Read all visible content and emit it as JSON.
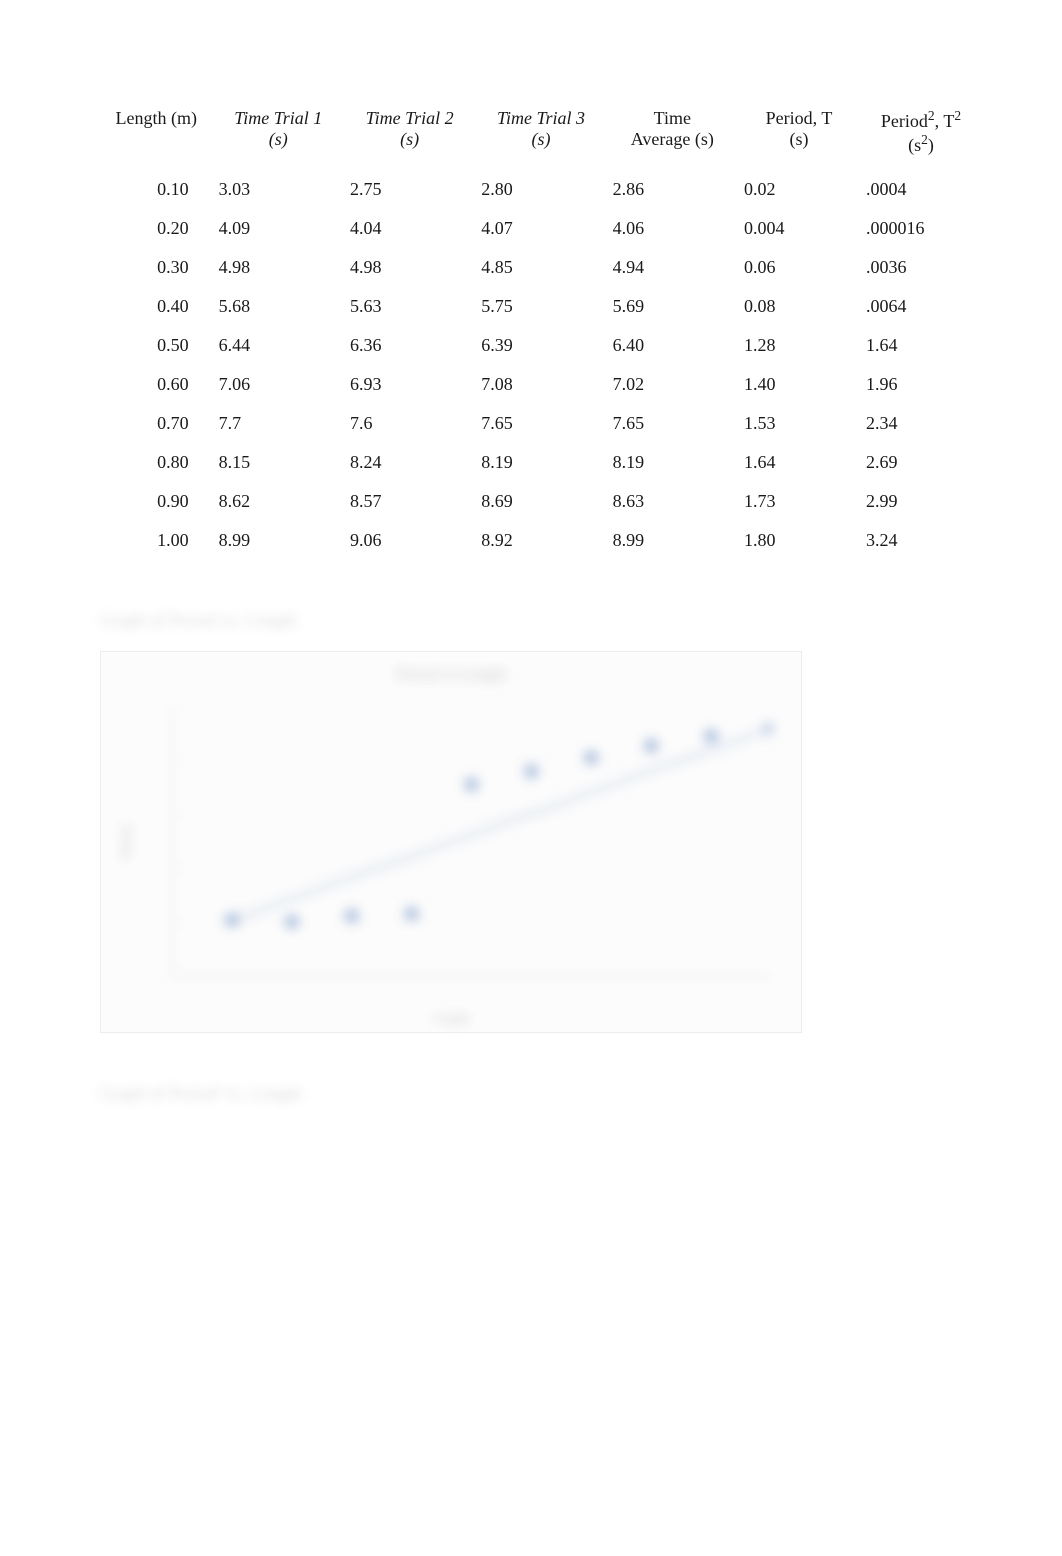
{
  "table": {
    "headers": [
      {
        "l1": "Length (m)",
        "l2": ""
      },
      {
        "l1": "Time Trial 1",
        "l2": "(s)"
      },
      {
        "l1": "Time Trial 2",
        "l2": "(s)"
      },
      {
        "l1": "Time Trial 3",
        "l2": "(s)"
      },
      {
        "l1": "Time",
        "l2": "Average (s)"
      },
      {
        "l1": "Period, T",
        "l2": "(s)"
      },
      {
        "l1": "Period², T²",
        "l2": "(s²)"
      }
    ],
    "rows": [
      [
        "0.10",
        "3.03",
        "2.75",
        "2.80",
        "2.86",
        "0.02",
        ".0004"
      ],
      [
        "0.20",
        "4.09",
        "4.04",
        "4.07",
        "4.06",
        "0.004",
        ".000016"
      ],
      [
        "0.30",
        "4.98",
        "4.98",
        "4.85",
        "4.94",
        "0.06",
        ".0036"
      ],
      [
        "0.40",
        "5.68",
        "5.63",
        "5.75",
        "5.69",
        "0.08",
        ".0064"
      ],
      [
        "0.50",
        "6.44",
        "6.36",
        "6.39",
        "6.40",
        "1.28",
        "1.64"
      ],
      [
        "0.60",
        "7.06",
        "6.93",
        "7.08",
        "7.02",
        "1.40",
        "1.96"
      ],
      [
        "0.70",
        "7.7",
        "7.6",
        "7.65",
        "7.65",
        "1.53",
        "2.34"
      ],
      [
        "0.80",
        "8.15",
        "8.24",
        "8.19",
        "8.19",
        "1.64",
        "2.69"
      ],
      [
        "0.90",
        "8.62",
        "8.57",
        "8.69",
        "8.63",
        "1.73",
        "2.99"
      ],
      [
        "1.00",
        "8.99",
        "9.06",
        "8.92",
        "8.99",
        "1.80",
        "3.24"
      ]
    ]
  },
  "section_headings": {
    "s1": "Graph of Period vs. Length",
    "s2": "Graph of Period² vs. Length"
  },
  "chart_data": {
    "type": "scatter",
    "title": "Period vs Length",
    "xlabel": "Length",
    "ylabel": "Period",
    "xlim": [
      0,
      1.0
    ],
    "ylim": [
      -0.5,
      2.0
    ],
    "x": [
      0.1,
      0.2,
      0.3,
      0.4,
      0.5,
      0.6,
      0.7,
      0.8,
      0.9,
      1.0
    ],
    "y": [
      0.02,
      0.004,
      0.06,
      0.08,
      1.28,
      1.4,
      1.53,
      1.64,
      1.73,
      1.8
    ],
    "trend": {
      "type": "linear",
      "note": "blurred content; approximate"
    }
  }
}
